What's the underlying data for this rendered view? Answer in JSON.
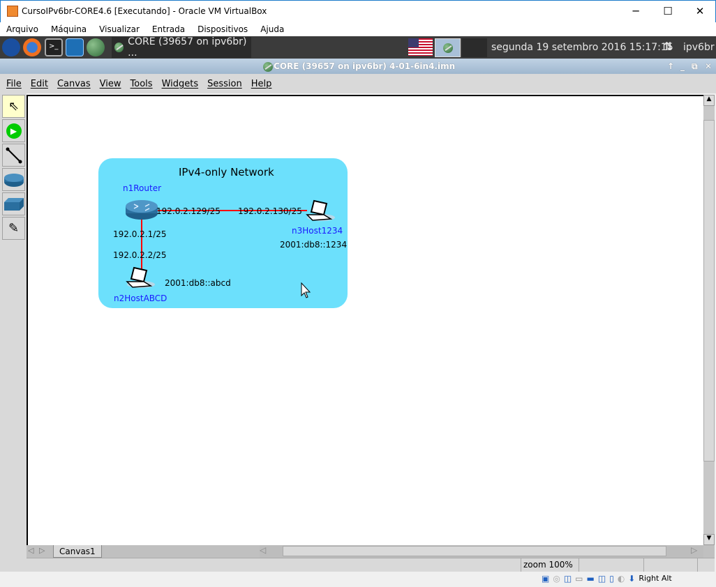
{
  "vbox": {
    "title": "CursoIPv6br-CORE4.6 [Executando] - Oracle VM VirtualBox",
    "menu": [
      "Arquivo",
      "Máquina",
      "Visualizar",
      "Entrada",
      "Dispositivos",
      "Ajuda"
    ],
    "host_key": "Right Alt"
  },
  "taskbar": {
    "task_label": "CORE (39657 on ipv6br) ...",
    "clock": "segunda 19 setembro 2016 15:17:15",
    "user": "ipv6br"
  },
  "core": {
    "title": "CORE (39657 on ipv6br) 4-01-6in4.imn",
    "menu": [
      "File",
      "Edit",
      "Canvas",
      "View",
      "Tools",
      "Widgets",
      "Session",
      "Help"
    ],
    "tools": [
      "select-tool",
      "start-session",
      "link-tool",
      "router-tool",
      "switch-tool",
      "annotation-tool"
    ],
    "canvas_tab": "Canvas1",
    "zoom": "zoom 100%"
  },
  "network": {
    "title": "IPv4-only Network",
    "fill": "#6ce0fc",
    "link_color": "#ff0000",
    "nodes": {
      "router": "n1Router",
      "host_a": "n2HostABCD",
      "host_b": "n3Host1234"
    },
    "labels": {
      "r_east": "192.0.2.129/25",
      "hb_west": "192.0.2.130/25",
      "r_south": "192.0.2.1/25",
      "ha_north": "192.0.2.2/25",
      "ha_v6": "2001:db8::abcd",
      "hb_v6": "2001:db8::1234"
    }
  }
}
